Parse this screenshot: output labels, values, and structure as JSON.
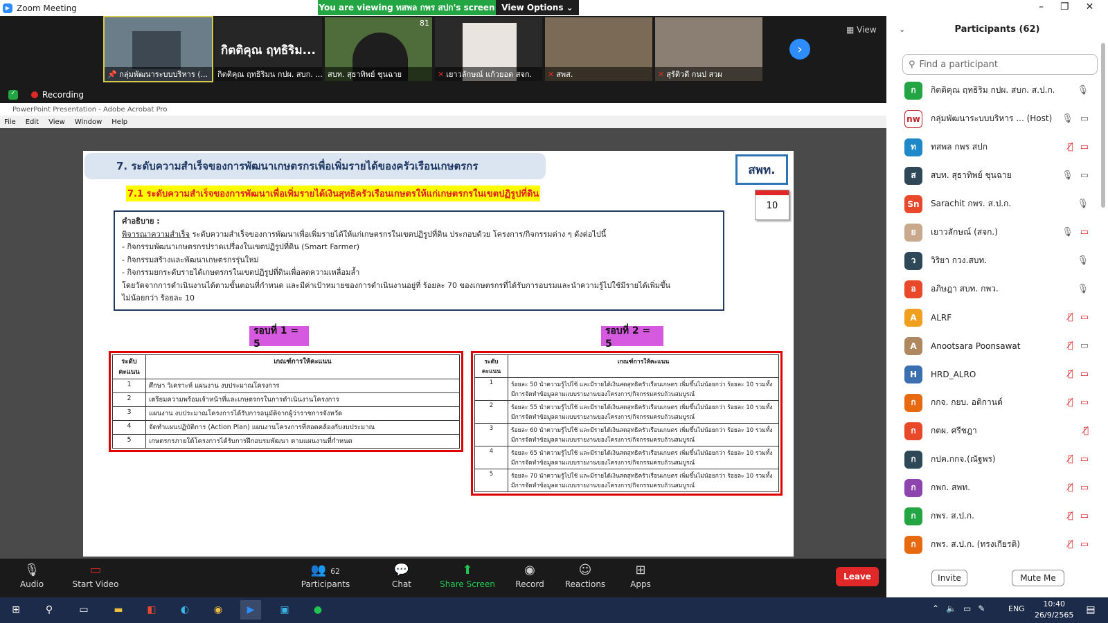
{
  "window": {
    "title": "Zoom Meeting"
  },
  "banner": {
    "viewing": "You are viewing ทสพล กพร สปก's screen",
    "view_options": "View Options ⌄"
  },
  "video_strip": {
    "tiles": [
      {
        "label": "กลุ่มพัฒนาระบบบริหาร (..."
      },
      {
        "label": "กิตติคุณ ฤทธิริมน กปผ. สบก. ...",
        "name": "กิตติคุณ ฤทธิริม..."
      },
      {
        "label": "สบท. สุธาทิพย์ ชุนฉาย",
        "corner": "81"
      },
      {
        "label": "เยาวลักษณ์ แก้วยอด สจก."
      },
      {
        "label": "สพส."
      },
      {
        "label": "สุรัติวดี กนป สวผ"
      }
    ],
    "view_label": "View",
    "recording": "Recording"
  },
  "acrobat": {
    "title": "PowerPoint Presentation - Adobe Acrobat Pro",
    "menu": [
      "File",
      "Edit",
      "View",
      "Window",
      "Help"
    ]
  },
  "slide": {
    "heading": "7. ระดับความสำเร็จของการพัฒนาเกษตรกรเพื่อเพิ่มรายได้ของครัวเรือนเกษตรกร",
    "subheading": "7.1 ระดับความสำเร็จของการพัฒนาเพื่อเพิ่มรายได้เงินสุทธิครัวเรือนเกษตรให้แก่เกษตรกรในเขตปฏิรูปที่ดิน",
    "unit": "สพท.",
    "calendar": "10",
    "desc_title": "คำอธิบาย :",
    "desc_lead": "พิจารณาความสำเร็จ",
    "desc_lines": [
      " ระดับความสำเร็จของการพัฒนาเพื่อเพิ่มรายได้ให้แก่เกษตรกรในเขตปฏิรูปที่ดิน ประกอบด้วย โครงการ/กิจกรรมต่าง ๆ ดังต่อไปนี้",
      "- กิจกรรมพัฒนาเกษตรกรปราดเปรื่องในเขตปฏิรูปที่ดิน (Smart Farmer)",
      "- กิจกรรมสร้างและพัฒนาเกษตรกรรุ่นใหม่",
      "- กิจกรรมยกระดับรายได้เกษตรกรในเขตปฏิรูปที่ดินเพื่อลดความเหลื่อมล้ำ",
      "โดยวัดจากการดำเนินงานได้ตามขั้นตอนที่กำหนด และมีค่าเป้าหมายของการดำเนินงานอยู่ที่ ร้อยละ 70 ของเกษตรกรที่ได้รับการอบรมและนำความรู้ไปใช้มีรายได้เพิ่มขึ้น",
      "ไม่น้อยกว่า ร้อยละ 10"
    ],
    "round1": "รอบที่ 1 = 5",
    "round2": "รอบที่ 2 = 5",
    "table1": {
      "headers": [
        "ระดับ คะแนน",
        "เกณฑ์การให้คะแนน"
      ],
      "rows": [
        [
          "1",
          "ศึกษา วิเคราะห์ แผนงาน งบประมาณโครงการ"
        ],
        [
          "2",
          "เตรียมความพร้อมเจ้าหน้าที่และเกษตรกรในการดำเนินงานโครงการ"
        ],
        [
          "3",
          "แผนงาน งบประมาณโครงการได้รับการอนุมัติจากผู้ว่าราชการจังหวัด"
        ],
        [
          "4",
          "จัดทำแผนปฏิบัติการ (Action Plan) แผนงานโครงการที่สอดคล้องกับงบประมาณ"
        ],
        [
          "5",
          "เกษตรกรภายใต้โครงการได้รับการฝึกอบรมพัฒนา ตามแผนงานที่กำหนด"
        ]
      ]
    },
    "table2": {
      "headers": [
        "ระดับ คะแนน",
        "เกณฑ์การให้คะแนน"
      ],
      "rows": [
        [
          "1",
          "ร้อยละ 50 นำความรู้ไปใช้ และมีรายได้เงินสดสุทธิครัวเรือนเกษตร เพิ่มขึ้นไม่น้อยกว่า ร้อยละ 10 รวมทั้งมีการจัดทำข้อมูลตามแบบรายงานของโครงการ/กิจกรรมครบถ้วนสมบูรณ์"
        ],
        [
          "2",
          "ร้อยละ 55 นำความรู้ไปใช้ และมีรายได้เงินสดสุทธิครัวเรือนเกษตร เพิ่มขึ้นไม่น้อยกว่า ร้อยละ 10 รวมทั้งมีการจัดทำข้อมูลตามแบบรายงานของโครงการ/กิจกรรมครบถ้วนสมบูรณ์"
        ],
        [
          "3",
          "ร้อยละ 60 นำความรู้ไปใช้ และมีรายได้เงินสดสุทธิครัวเรือนเกษตร เพิ่มขึ้นไม่น้อยกว่า ร้อยละ 10 รวมทั้งมีการจัดทำข้อมูลตามแบบรายงานของโครงการ/กิจกรรมครบถ้วนสมบูรณ์"
        ],
        [
          "4",
          "ร้อยละ 65 นำความรู้ไปใช้ และมีรายได้เงินสดสุทธิครัวเรือนเกษตร เพิ่มขึ้นไม่น้อยกว่า ร้อยละ 10 รวมทั้งมีการจัดทำข้อมูลตามแบบรายงานของโครงการ/กิจกรรมครบถ้วนสมบูรณ์"
        ],
        [
          "5",
          "ร้อยละ 70 นำความรู้ไปใช้ และมีรายได้เงินสดสุทธิครัวเรือนเกษตร เพิ่มขึ้นไม่น้อยกว่า ร้อยละ 10 รวมทั้งมีการจัดทำข้อมูลตามแบบรายงานของโครงการ/กิจกรรมครบถ้วนสมบูรณ์"
        ]
      ]
    }
  },
  "participants": {
    "title": "Participants (62)",
    "search_placeholder": "Find a participant",
    "list": [
      {
        "initial": "ก",
        "color": "#23a544",
        "name": "กิตติคุณ ฤทธิริม กปผ. สบก. ส.ป.ก. (Me)",
        "mic": "on",
        "video": ""
      },
      {
        "initial": "nw",
        "color": "#ffffff",
        "name": "กลุ่มพัฒนาระบบบริหาร ... (Host)",
        "mic": "on",
        "video": "on"
      },
      {
        "initial": "ท",
        "color": "#1e88c8",
        "name": "ทสพล กพร สปก",
        "mic": "off",
        "video": "off"
      },
      {
        "initial": "ส",
        "color": "#2f4858",
        "name": "สบท. สุธาทิพย์ ชุนฉาย",
        "mic": "on",
        "video": "on"
      },
      {
        "initial": "Sn",
        "color": "#e8492b",
        "name": "Sarachit กพร. ส.ป.ก.",
        "mic": "on",
        "video": ""
      },
      {
        "initial": "ย",
        "color": "#c8a98c",
        "name": "เยาวลักษณ์ (สจก.)",
        "mic": "on",
        "video": "off"
      },
      {
        "initial": "ว",
        "color": "#2f4858",
        "name": "วิริยา กวง.สบท.",
        "mic": "on",
        "video": ""
      },
      {
        "initial": "อ",
        "color": "#e8492b",
        "name": "อภิษฎา สบท. กพว.",
        "mic": "on",
        "video": ""
      },
      {
        "initial": "A",
        "color": "#f0a020",
        "name": "ALRF",
        "mic": "off",
        "video": "off"
      },
      {
        "initial": "A",
        "color": "#b08860",
        "name": "Anootsara Poonsawat",
        "mic": "off",
        "video": "on"
      },
      {
        "initial": "H",
        "color": "#3a6fb0",
        "name": "HRD_ALRO",
        "mic": "off",
        "video": "off"
      },
      {
        "initial": "ก",
        "color": "#e86a10",
        "name": "กกจ. กยบ. อติกานต์",
        "mic": "off",
        "video": "off"
      },
      {
        "initial": "ก",
        "color": "#e8492b",
        "name": "กตผ. ศรีชฎา",
        "mic": "off",
        "video": ""
      },
      {
        "initial": "ก",
        "color": "#2f4858",
        "name": "กปค.กกจ.(ณัฐพร)",
        "mic": "off",
        "video": "off"
      },
      {
        "initial": "ก",
        "color": "#8e44ad",
        "name": "กพก. สพท.",
        "mic": "off",
        "video": "off"
      },
      {
        "initial": "ก",
        "color": "#23a544",
        "name": "กพร. ส.ป.ก.",
        "mic": "off",
        "video": "off"
      },
      {
        "initial": "ก",
        "color": "#e86a10",
        "name": "กพร. ส.ป.ก. (ทรงเกียรติ)",
        "mic": "off",
        "video": "off"
      }
    ],
    "invite": "Invite",
    "mute_me": "Mute Me"
  },
  "toolbar": {
    "audio": "Audio",
    "video": "Start Video",
    "participants": "Participants",
    "participants_count": "62",
    "chat": "Chat",
    "share": "Share Screen",
    "record": "Record",
    "reactions": "Reactions",
    "apps": "Apps",
    "leave": "Leave"
  },
  "taskbar": {
    "lang": "ENG",
    "time": "10:40",
    "date": "26/9/2565"
  }
}
